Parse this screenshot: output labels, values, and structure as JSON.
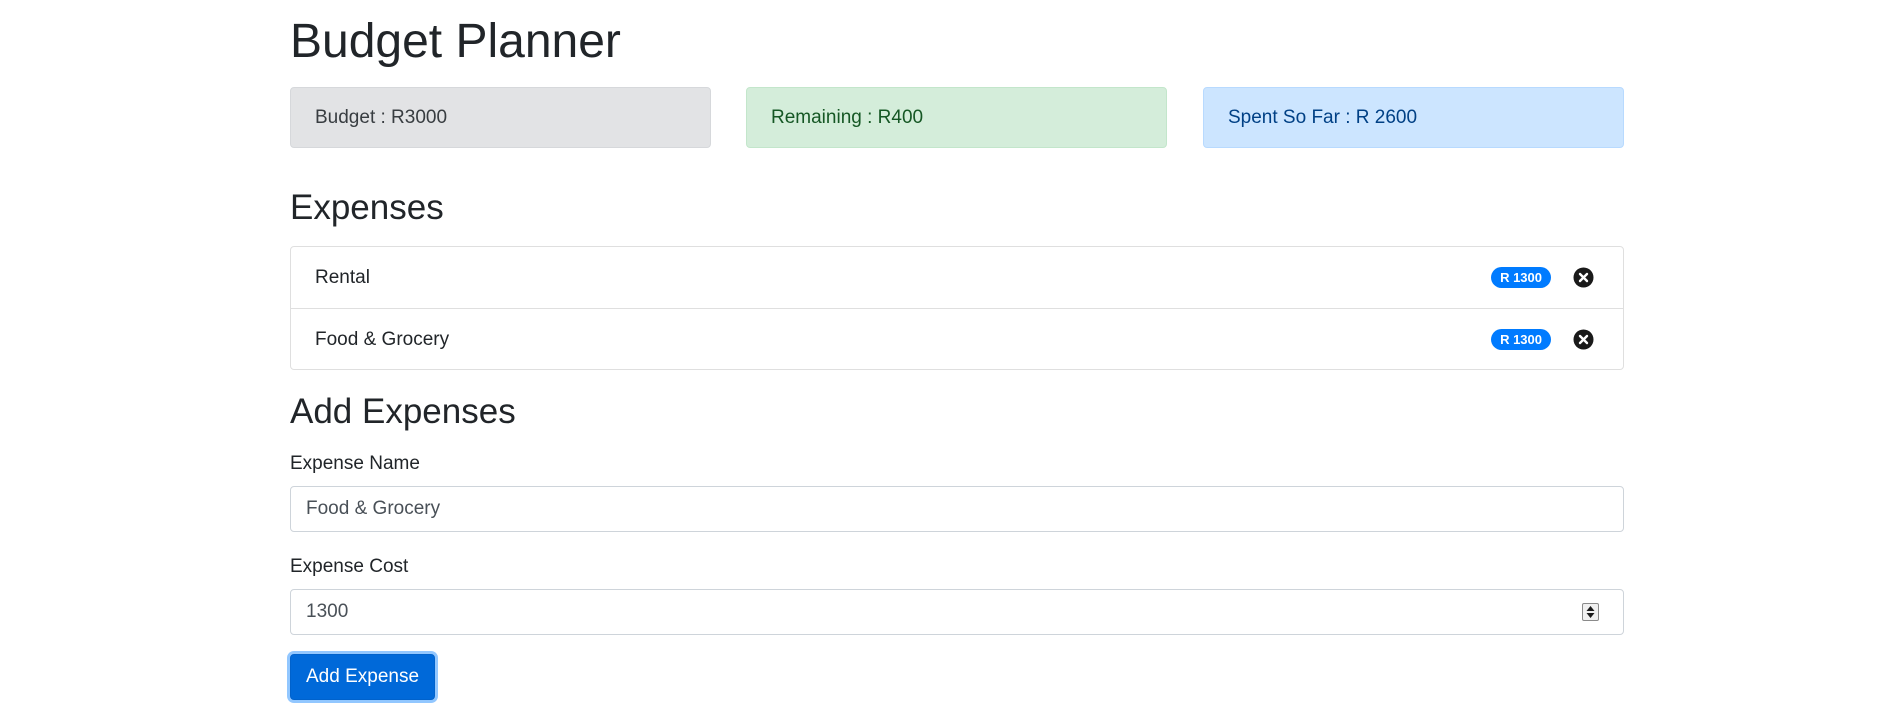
{
  "app": {
    "title": "Budget Planner"
  },
  "summary": {
    "budget": "Budget : R3000",
    "remaining": "Remaining : R400",
    "spent": "Spent So Far : R 2600"
  },
  "expenses": {
    "title": "Expenses",
    "items": [
      {
        "name": "Rental",
        "cost": "R 1300"
      },
      {
        "name": "Food & Grocery",
        "cost": "R 1300"
      }
    ],
    "delete_icon": "close-circle-icon"
  },
  "add_form": {
    "title": "Add Expenses",
    "name_label": "Expense Name",
    "name_value": "Food & Grocery",
    "cost_label": "Expense Cost",
    "cost_value": "1300",
    "submit_label": "Add Expense"
  },
  "colors": {
    "primary": "#007bff",
    "success_bg": "#d4edda",
    "info_bg": "#cce5ff",
    "secondary_bg": "#e2e3e5"
  }
}
